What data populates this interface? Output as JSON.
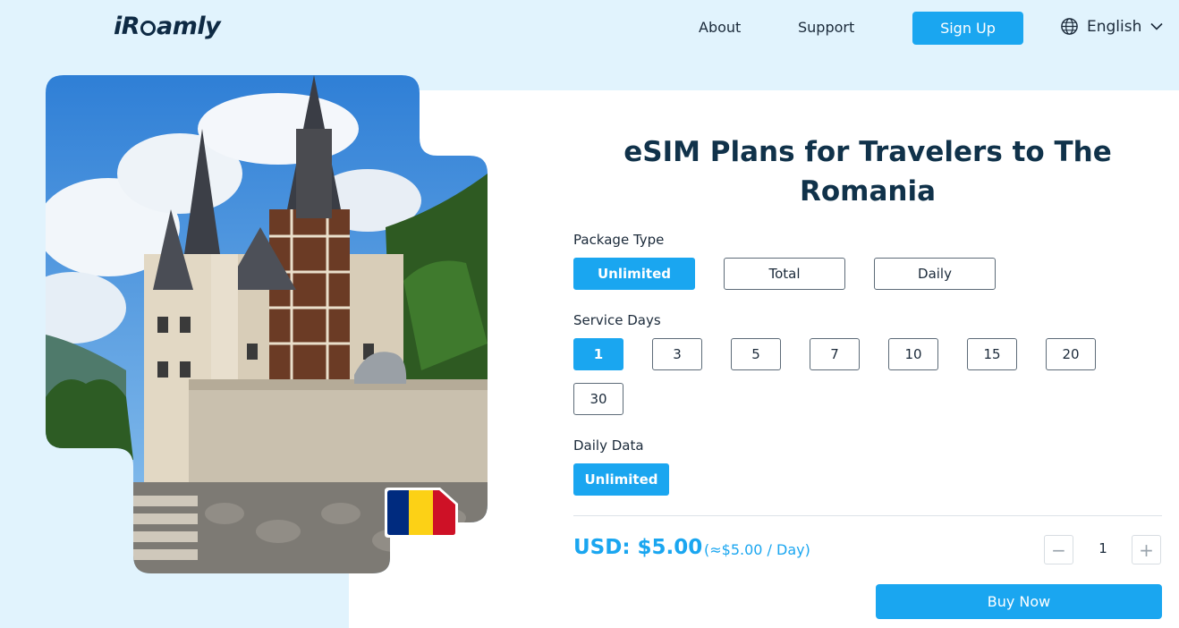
{
  "header": {
    "logo_prefix": "iR",
    "logo_suffix": "amly",
    "nav": {
      "about": "About",
      "support": "Support"
    },
    "signup_label": "Sign Up",
    "language": "English",
    "globe_icon": "globe-icon",
    "chevron_icon": "chevron-down-icon"
  },
  "hero": {
    "flag_colors": [
      "#002b7f",
      "#fcd116",
      "#ce1126"
    ]
  },
  "main": {
    "title": "eSIM Plans for Travelers to The Romania",
    "package_type": {
      "label": "Package Type",
      "options": [
        "Unlimited",
        "Total",
        "Daily"
      ],
      "selected": "Unlimited"
    },
    "service_days": {
      "label": "Service Days",
      "options": [
        "1",
        "3",
        "5",
        "7",
        "10",
        "15",
        "20",
        "30"
      ],
      "selected": "1"
    },
    "daily_data": {
      "label": "Daily Data",
      "options": [
        "Unlimited"
      ],
      "selected": "Unlimited"
    },
    "price": "USD: $5.00",
    "price_per_day": "(≈$5.00 / Day)",
    "quantity": {
      "minus": "−",
      "value": "1",
      "plus": "+"
    },
    "buy_label": "Buy Now"
  },
  "colors": {
    "accent": "#1aa6f0",
    "background_tint": "#e1f3fd",
    "title": "#10324a"
  }
}
